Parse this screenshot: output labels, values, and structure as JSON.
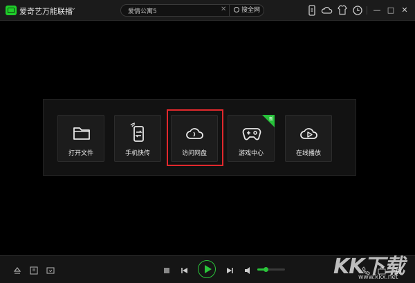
{
  "app": {
    "title": "爱奇艺万能联播",
    "menu_icon": "chevron-down-icon"
  },
  "search": {
    "value": "爱情公寓5",
    "clear_icon": "close-icon",
    "button_label": "搜全网"
  },
  "toolbar": {
    "icons": [
      "phone-transfer-icon",
      "cloud-icon",
      "skin-icon",
      "history-clock-icon"
    ],
    "window_controls": [
      "minimize",
      "maximize",
      "close"
    ],
    "window_glyphs": [
      "—",
      "□",
      "✕"
    ]
  },
  "launcher": {
    "tiles": [
      {
        "label": "打开文件",
        "icon": "folder-icon"
      },
      {
        "label": "手机快传",
        "icon": "phone-transfer-icon"
      },
      {
        "label": "访问网盘",
        "icon": "cloud-drive-icon",
        "highlighted": true
      },
      {
        "label": "游戏中心",
        "icon": "gamepad-icon",
        "badge": "新"
      },
      {
        "label": "在线播放",
        "icon": "cloud-play-icon"
      }
    ]
  },
  "player": {
    "left_icons": [
      "eject-icon",
      "playlist-icon",
      "screenshot-icon"
    ],
    "controls": [
      "stop-icon",
      "previous-icon",
      "play-icon",
      "next-icon",
      "volume-icon"
    ],
    "volume_level": 0.3,
    "right_icons": [
      "phone-icon",
      "toolbox-icon",
      "settings-icon"
    ]
  },
  "accent_color": "#2ac43a",
  "highlight_color": "#e2282c",
  "watermark": {
    "big": "KK下载",
    "small": "www.kkx.net"
  }
}
